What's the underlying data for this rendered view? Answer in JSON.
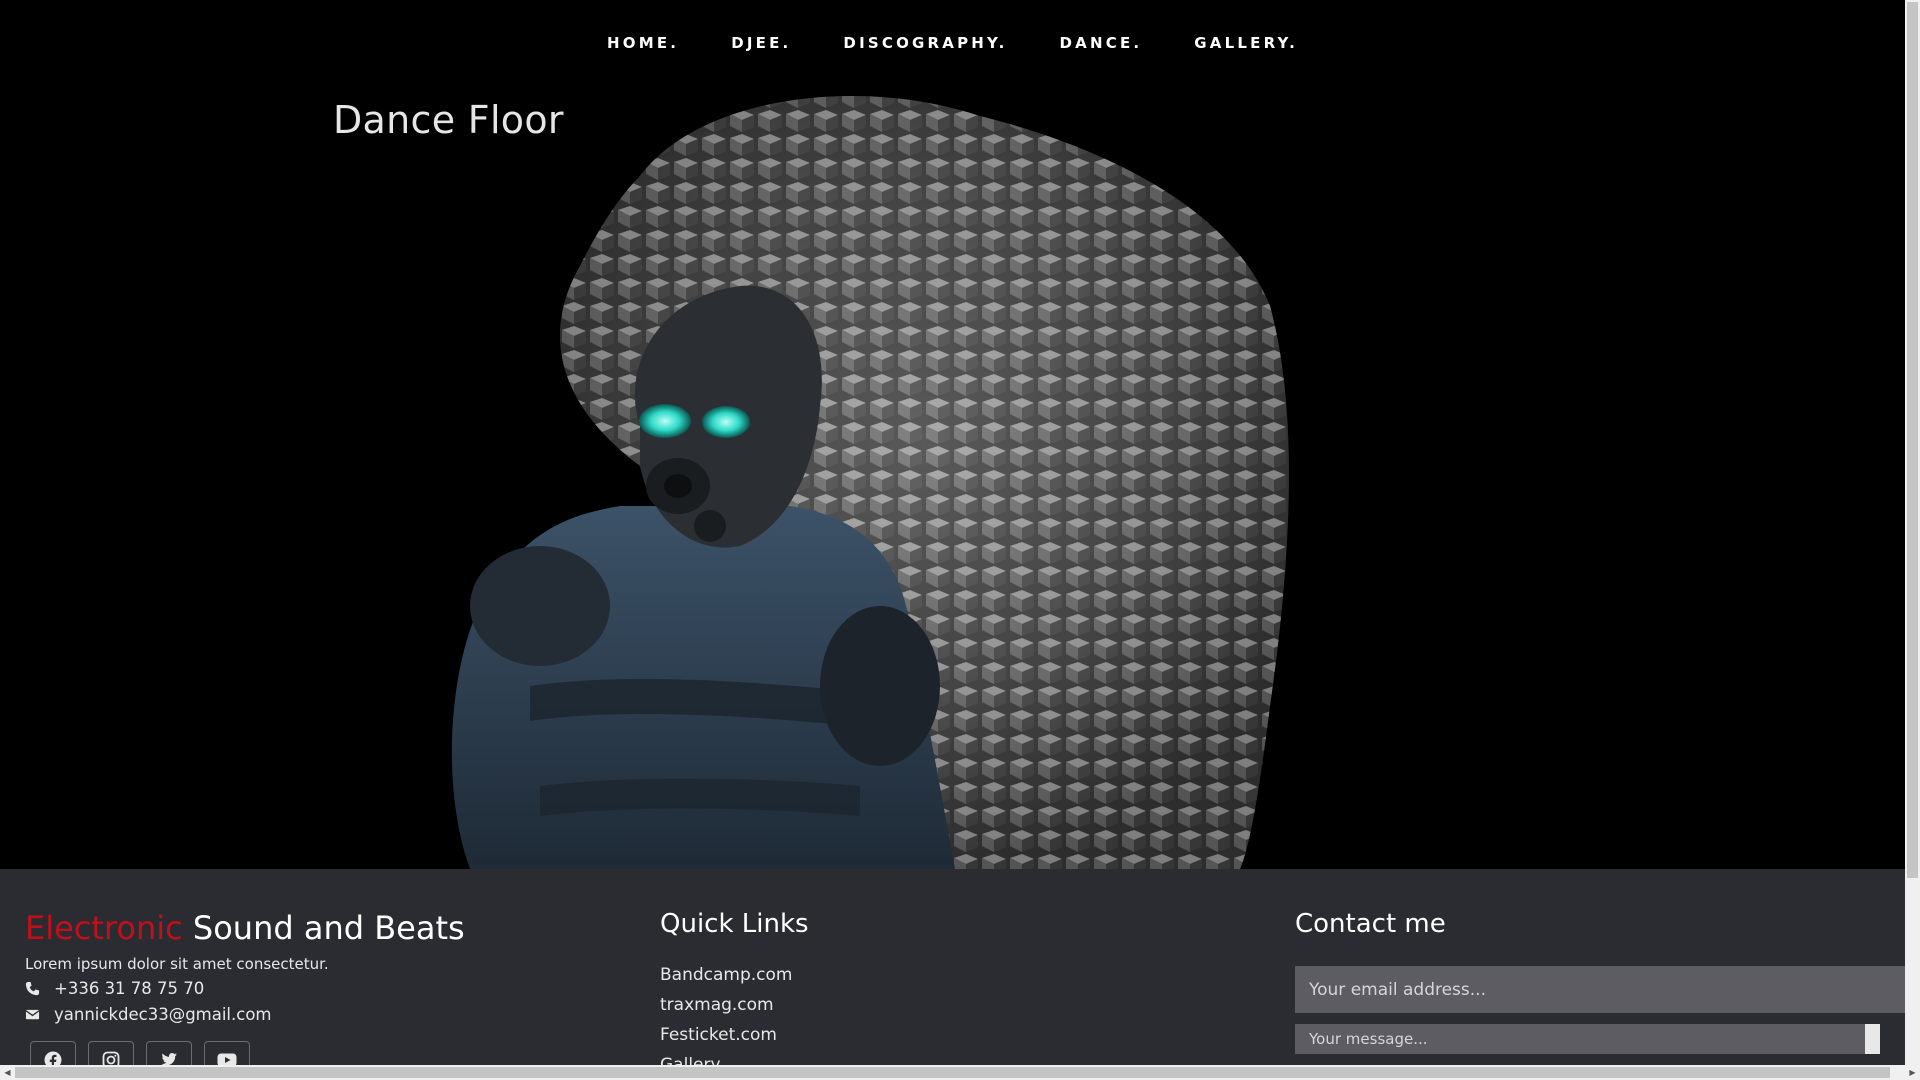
{
  "nav": {
    "items": [
      {
        "label": "HOME."
      },
      {
        "label": "DJEE."
      },
      {
        "label": "DISCOGRAPHY."
      },
      {
        "label": "DANCE."
      },
      {
        "label": "GALLERY."
      }
    ]
  },
  "hero": {
    "title": "Dance Floor"
  },
  "footer": {
    "brand": {
      "accent": "Electronic",
      "rest": " Sound and Beats",
      "accent_color": "#c0101a",
      "description": "Lorem ipsum dolor sit amet consectetur.",
      "phone": "+336 31 78 75 70",
      "email": "yannickdec33@gmail.com",
      "phone_icon": "phone-icon",
      "email_icon": "envelope-icon"
    },
    "socials": [
      {
        "icon": "facebook-icon"
      },
      {
        "icon": "instagram-icon"
      },
      {
        "icon": "twitter-icon"
      },
      {
        "icon": "youtube-icon"
      }
    ],
    "quick_links": {
      "title": "Quick Links",
      "items": [
        {
          "label": "Bandcamp.com"
        },
        {
          "label": "traxmag.com"
        },
        {
          "label": "Festicket.com"
        },
        {
          "label": "Gallery"
        }
      ]
    },
    "contact": {
      "title": "Contact me",
      "email_placeholder": "Your email address...",
      "message_placeholder": "Your message..."
    }
  },
  "colors": {
    "background": "#000000",
    "footer_bg": "#2b2b32",
    "input_bg": "#5c5c62"
  }
}
